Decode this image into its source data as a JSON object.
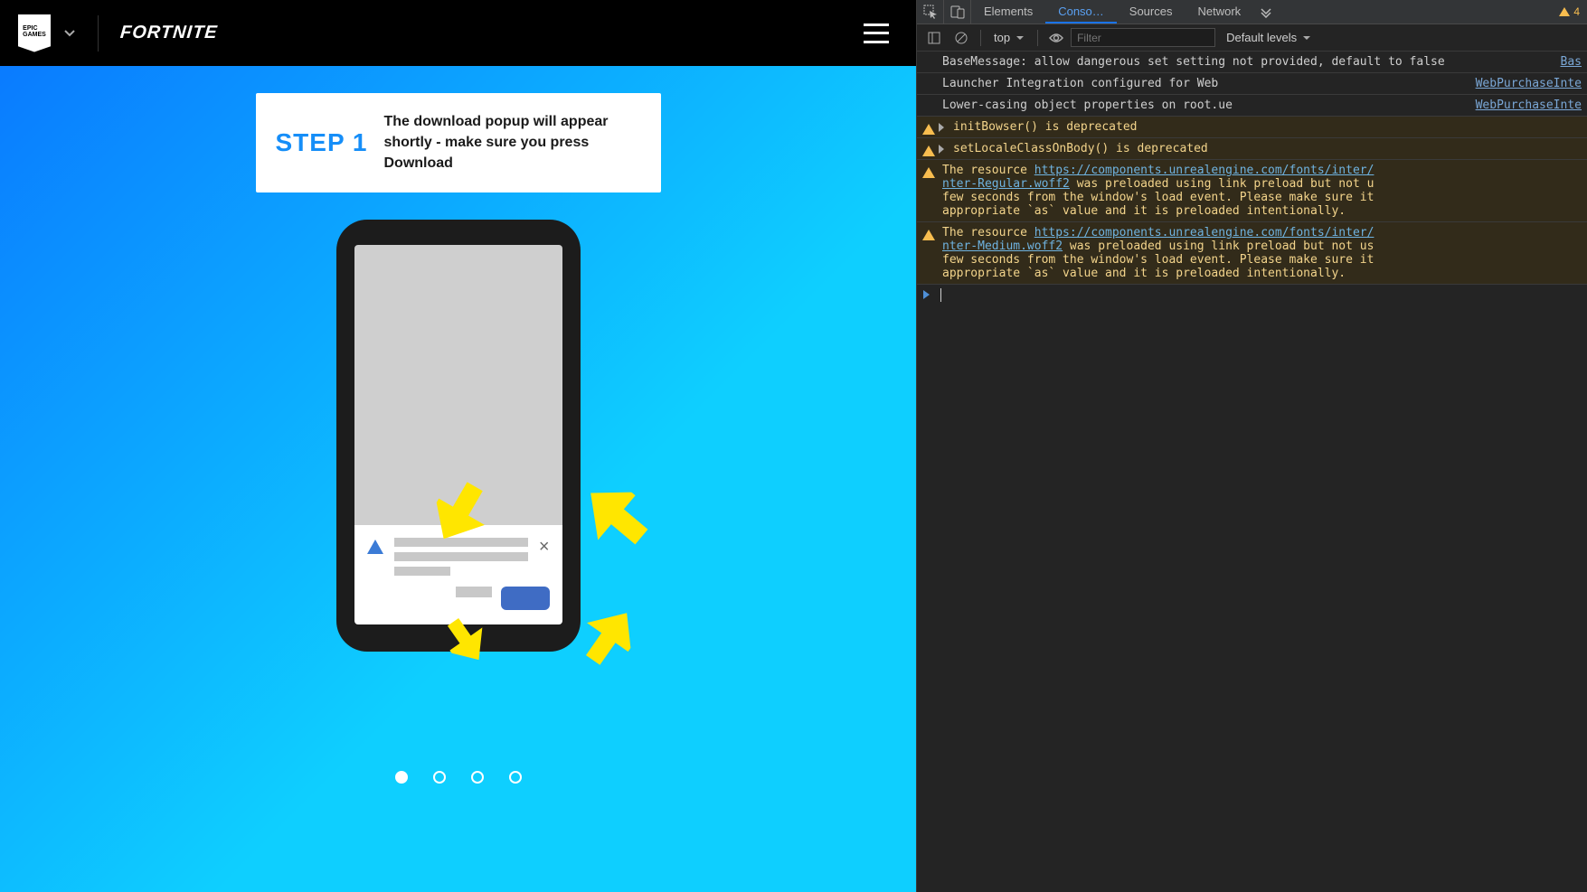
{
  "page": {
    "brand_left": "EPIC GAMES",
    "brand_right": "FORTNITE",
    "step": {
      "label": "STEP 1",
      "text": "The download popup will appear shortly - make sure you press Download"
    },
    "dots_total": 4,
    "dots_active_index": 0
  },
  "devtools": {
    "tabs": {
      "elements": "Elements",
      "console": "Conso…",
      "sources": "Sources",
      "network": "Network"
    },
    "warning_badge": "4",
    "toolbar": {
      "context": "top",
      "filter_placeholder": "Filter",
      "levels": "Default levels"
    },
    "messages": [
      {
        "kind": "info",
        "text": "BaseMessage: allow dangerous set setting not provided, default to false",
        "src": "Bas"
      },
      {
        "kind": "info",
        "text": "Launcher Integration configured for Web",
        "src": "WebPurchaseInte"
      },
      {
        "kind": "info",
        "text": "Lower-casing object properties on root.ue",
        "src": "WebPurchaseInte"
      },
      {
        "kind": "warn",
        "disclose": true,
        "text": "initBowser() is deprecated",
        "src": ""
      },
      {
        "kind": "warn",
        "disclose": true,
        "text": "setLocaleClassOnBody() is deprecated",
        "src": ""
      },
      {
        "kind": "warn",
        "pre": "The resource ",
        "link": "https://components.unrealengine.com/fonts/inter/",
        "link2": "nter-Regular.woff2",
        "post": " was preloaded using link preload but not u\nfew seconds from the window's load event. Please make sure it\nappropriate `as` value and it is preloaded intentionally.",
        "src": ""
      },
      {
        "kind": "warn",
        "pre": "The resource ",
        "link": "https://components.unrealengine.com/fonts/inter/",
        "link2": "nter-Medium.woff2",
        "post": " was preloaded using link preload but not us\nfew seconds from the window's load event. Please make sure it\nappropriate `as` value and it is preloaded intentionally.",
        "src": ""
      }
    ]
  }
}
